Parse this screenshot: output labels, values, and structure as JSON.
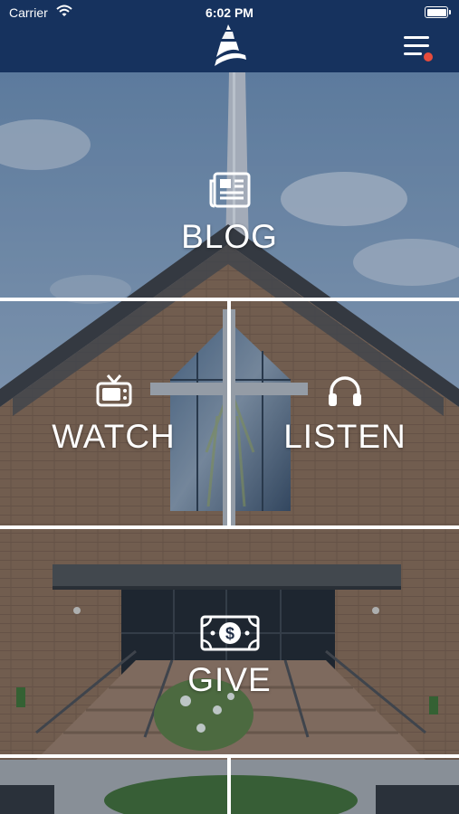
{
  "status_bar": {
    "carrier": "Carrier",
    "time": "6:02 PM"
  },
  "header": {
    "logo_icon": "steeple-logo-icon",
    "menu_icon": "hamburger-menu-icon",
    "notification_dot_color": "#e74c3c",
    "background_color": "#16325e"
  },
  "tiles": {
    "blog": {
      "label": "BLOG",
      "icon": "newspaper-icon"
    },
    "watch": {
      "label": "WATCH",
      "icon": "tv-icon"
    },
    "listen": {
      "label": "LISTEN",
      "icon": "headphones-icon"
    },
    "give": {
      "label": "GIVE",
      "icon": "dollar-bill-icon"
    }
  },
  "background_image": "church-building-with-steeple-photo"
}
